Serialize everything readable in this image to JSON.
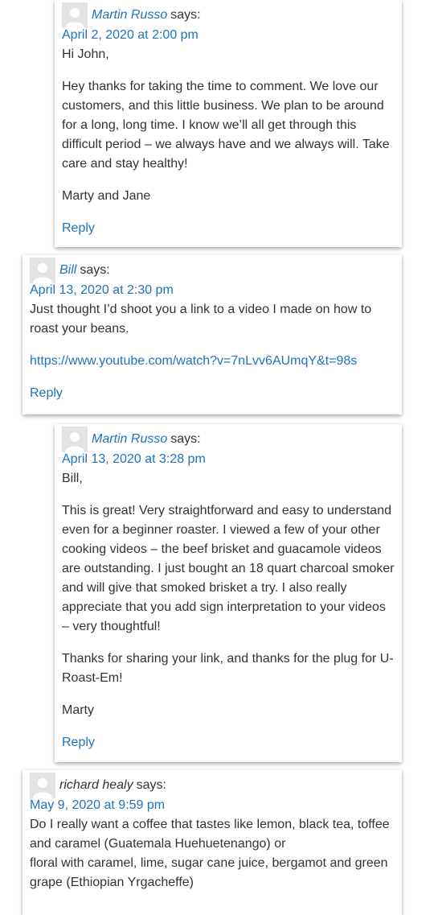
{
  "comments": [
    {
      "author": "Martin Russo",
      "says": "says:",
      "date": "April 2, 2020 at 2:00 pm",
      "paragraphs": [
        "Hi John,",
        "Hey thanks for taking the time to comment. We love our customers, and this little business. We plan to be around for a long, long time. I know we’ll all get through this difficult period – we always have and we always will. Take care and stay healthy!",
        "Marty and Jane"
      ],
      "reply_label": "Reply"
    },
    {
      "author": "Bill",
      "says": "says:",
      "date": "April 13, 2020 at 2:30 pm",
      "paragraphs": [
        "Just thought I’d shoot you a link to a video I made on how to roast your beans."
      ],
      "link": "https://www.youtube.com/watch?v=7nLvv6AUmqY&t=98s",
      "reply_label": "Reply"
    },
    {
      "author": "Martin Russo",
      "says": "says:",
      "date": "April 13, 2020 at 3:28 pm",
      "paragraphs": [
        "Bill,",
        "This is great! Very straightforward and easy to understand even for a beginner roaster. I viewed a few of your other cooking videos – the beef brisket and guacamole videos are outstanding. I just bought an 18 quart charcoal smoker and will give that smoked brisket a try. I also really appreciate that you add sign interpretation to your videos – very thoughtful!",
        "Thanks for sharing your link, and thanks for the plug for U-Roast-Em!",
        "Marty"
      ],
      "reply_label": "Reply"
    },
    {
      "author": "richard healy",
      "says": "says:",
      "date": "May 9, 2020 at 9:59 pm",
      "paragraphs": [
        "Do I really want a coffee that tastes like lemon, black tea, toffee and caramel (Guatemala Huehuetenango) or",
        "floral with caramel, lime, sugar cane juice, bergamot and green grape (Ethiopian Yrgacheffe)"
      ]
    }
  ],
  "colors": {
    "link": "#1e73be",
    "text": "#333333",
    "avatar_bg": "#e3e3e3"
  },
  "icons": {
    "avatar": "default-avatar-icon"
  }
}
